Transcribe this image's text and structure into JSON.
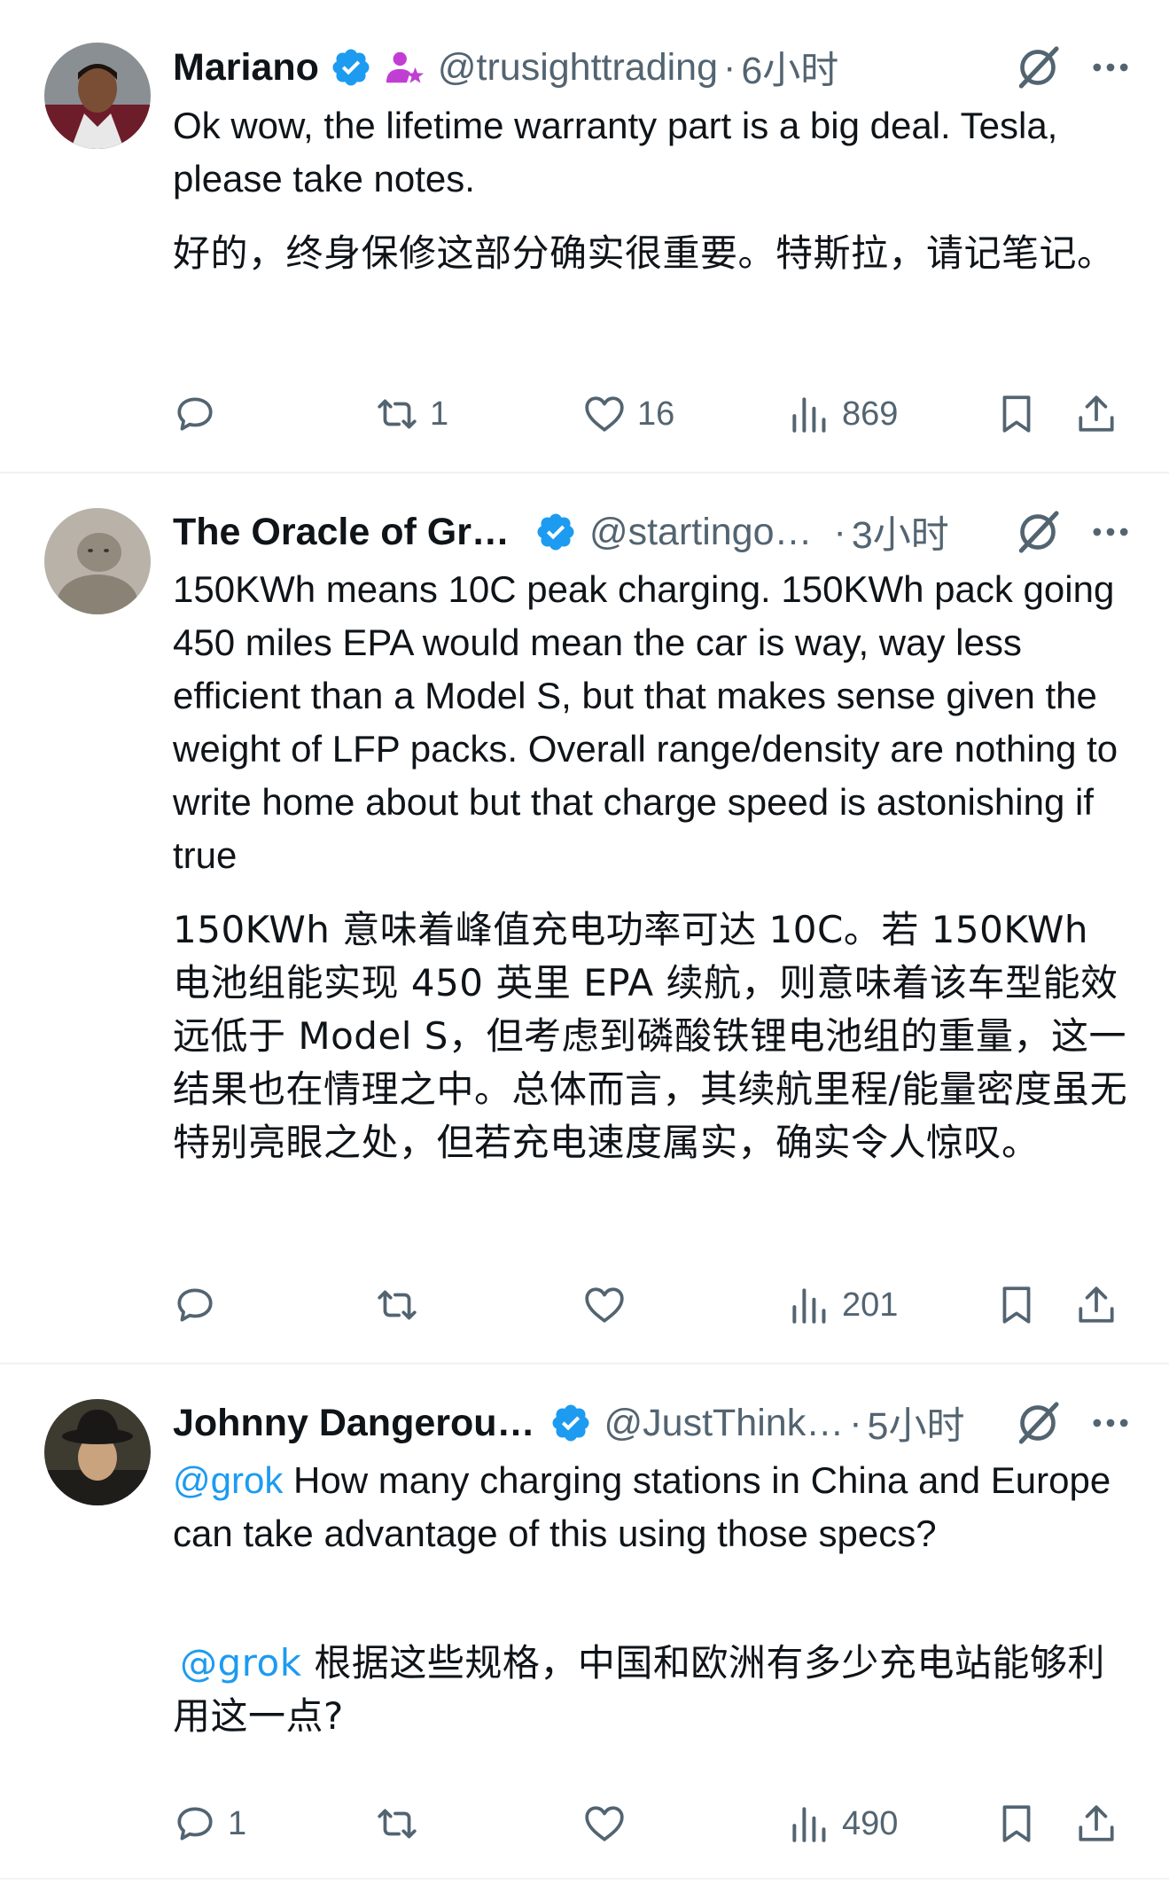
{
  "colors": {
    "accent": "#1d9bf0",
    "text": "#0f1419",
    "muted": "#536471",
    "divider": "#eff3f4"
  },
  "tweets": [
    {
      "name": "Mariano",
      "handle": "@trusighttrading",
      "separator": "·",
      "time": "6小时",
      "text": "Ok wow, the lifetime warranty part is a big deal. Tesla, please take notes.",
      "translation": "好的，终身保修这部分确实很重要。特斯拉，请记笔记。",
      "replies": "",
      "reposts": "1",
      "likes": "16",
      "views": "869",
      "avatar_icon": "man-in-red-jacket-avatar"
    },
    {
      "name": "The Oracle of Gr…",
      "handle": "@startingo…",
      "separator": "·",
      "time": "3小时",
      "text": "150KWh means 10C peak charging. 150KWh pack going 450 miles EPA would mean the car is way, way less efficient than a Model S, but that makes sense given the weight of LFP packs. Overall range/density are nothing to write home about but that charge speed is astonishing if true",
      "translation": "150KWh 意味着峰值充电功率可达 10C。若 150KWh 电池组能实现 450 英里 EPA 续航，则意味着该车型能效远低于 Model S，但考虑到磷酸铁锂电池组的重量，这一结果也在情理之中。总体而言，其续航里程/能量密度虽无特别亮眼之处，但若充电速度属实，确实令人惊叹。",
      "replies": "",
      "reposts": "",
      "likes": "",
      "views": "201",
      "avatar_icon": "clay-figure-avatar"
    },
    {
      "name": "Johnny Dangerou…",
      "handle": "@JustThink…",
      "separator": "·",
      "time": "5小时",
      "mention": "@grok",
      "text": " How many charging stations in China and Europe can take advantage of this using those specs?",
      "translation_mention": "@grok",
      "translation": " 根据这些规格，中国和欧洲有多少充电站能够利用这一点?",
      "replies": "1",
      "reposts": "",
      "likes": "",
      "views": "490",
      "avatar_icon": "man-in-hat-avatar"
    }
  ]
}
